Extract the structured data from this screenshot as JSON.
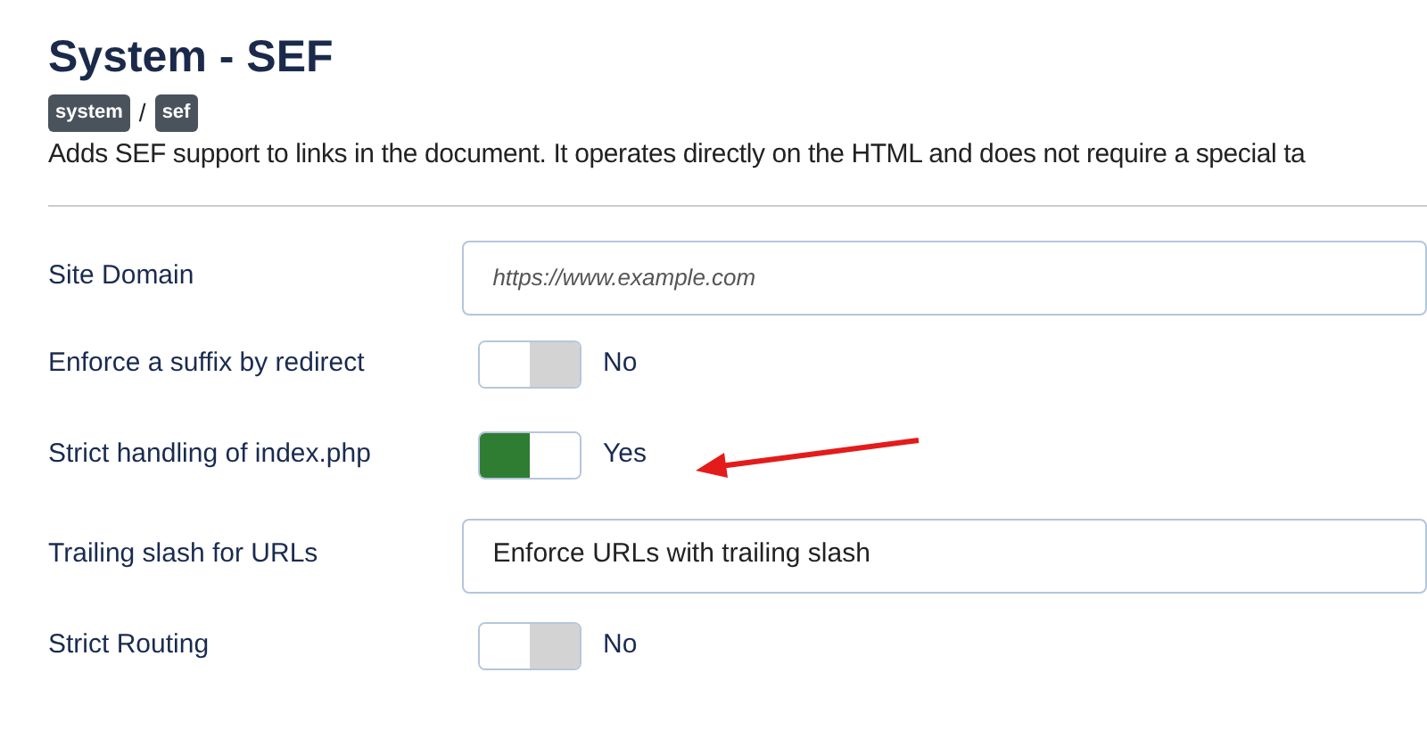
{
  "title": "System - SEF",
  "badges": [
    "system",
    "sef"
  ],
  "separator": "/",
  "description": "Adds SEF support to links in the document. It operates directly on the HTML and does not require a special ta",
  "fields": [
    {
      "kind": "text",
      "label": "Site Domain",
      "placeholder": "https://www.example.com"
    },
    {
      "kind": "switch",
      "label": "Enforce a suffix by redirect",
      "on": false,
      "state_text": "No"
    },
    {
      "kind": "switch",
      "label": "Strict handling of index.php",
      "on": true,
      "state_text": "Yes"
    },
    {
      "kind": "select",
      "label": "Trailing slash for URLs",
      "value": "Enforce URLs with trailing slash"
    },
    {
      "kind": "switch",
      "label": "Strict Routing",
      "on": false,
      "state_text": "No"
    }
  ]
}
